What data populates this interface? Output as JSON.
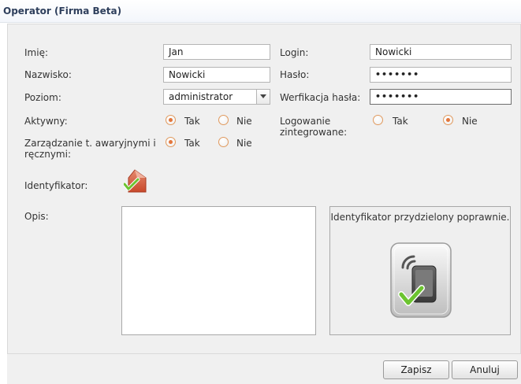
{
  "window": {
    "title": "Operator (Firma Beta)"
  },
  "form": {
    "first_name": {
      "label": "Imię:",
      "value": "Jan"
    },
    "last_name": {
      "label": "Nazwisko:",
      "value": "Nowicki"
    },
    "level": {
      "label": "Poziom:",
      "value": "administrator"
    },
    "active": {
      "label": "Aktywny:",
      "yes": "Tak",
      "no": "Nie",
      "selected": "Tak"
    },
    "emergency": {
      "label": "Zarządzanie t. awaryjnymi i ręcznymi:",
      "yes": "Tak",
      "no": "Nie",
      "selected": "Tak"
    },
    "login": {
      "label": "Login:",
      "value": "Nowicki"
    },
    "password": {
      "label": "Hasło:",
      "value": "•••••••"
    },
    "password_verify": {
      "label": "Werfikacja hasła:",
      "value": "•••••••"
    },
    "integrated_login": {
      "label": "Logowanie zintegrowane:",
      "yes": "Tak",
      "no": "Nie",
      "selected": "Nie"
    },
    "identifier": {
      "label": "Identyfikator:",
      "icon": "card-assigned-icon"
    },
    "description": {
      "label": "Opis:",
      "value": ""
    }
  },
  "identifier_box": {
    "message": "Identyfikator przydzielony poprawnie.",
    "icon": "rfid-card-check-icon"
  },
  "buttons": {
    "save": "Zapisz",
    "cancel": "Anuluj"
  },
  "colors": {
    "radio_accent": "#e2763c",
    "title_text": "#2e3f5c",
    "check_green": "#6cc430"
  }
}
